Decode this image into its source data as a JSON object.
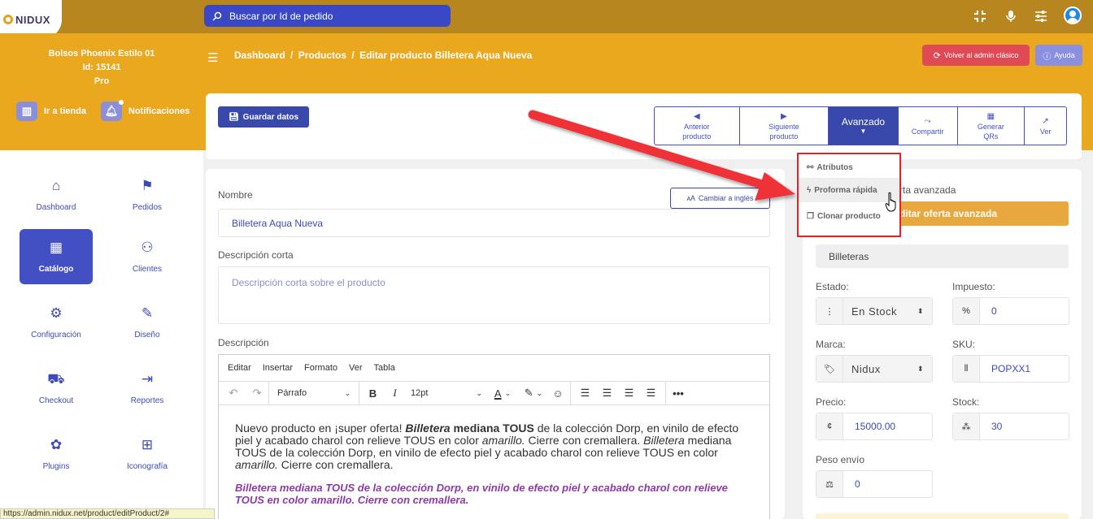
{
  "topbar": {
    "logo_text": "NIDUX",
    "search_placeholder": "Buscar por Id de pedido"
  },
  "store": {
    "name": "Bolsos Phoenix Estilo 01",
    "id": "Id: 15141",
    "plan": "Pro",
    "go_store": "Ir a tienda",
    "notifications": "Notificaciones"
  },
  "breadcrumb": {
    "dashboard": "Dashboard",
    "products": "Productos",
    "current": "Editar producto Billetera Aqua Nueva",
    "sep": "/"
  },
  "header_buttons": {
    "old_admin": "Volver al admin clásico",
    "help": "Ayuda"
  },
  "sidebar": {
    "items": [
      {
        "label": "Dashboard",
        "icon": "home-icon",
        "glyph": "⌂"
      },
      {
        "label": "Pedidos",
        "icon": "flag-icon",
        "glyph": "⚑"
      },
      {
        "label": "Catálogo",
        "icon": "boxes-icon",
        "glyph": "▦"
      },
      {
        "label": "Clientes",
        "icon": "users-icon",
        "glyph": "⚇"
      },
      {
        "label": "Configuración",
        "icon": "cubes-icon",
        "glyph": "⚙"
      },
      {
        "label": "Diseño",
        "icon": "brush-icon",
        "glyph": "✎"
      },
      {
        "label": "Checkout",
        "icon": "checkout-icon",
        "glyph": "⛟"
      },
      {
        "label": "Reportes",
        "icon": "report-icon",
        "glyph": "⇥"
      },
      {
        "label": "Plugins",
        "icon": "puzzle-icon",
        "glyph": "✿"
      },
      {
        "label": "Iconografía",
        "icon": "grid-icon",
        "glyph": "⊞"
      }
    ]
  },
  "actions": {
    "save": "Guardar datos",
    "prev": "Anterior producto",
    "next": "Siguiente producto",
    "advanced": "Avanzado",
    "share": "Compartir",
    "qr": "Generar QRs",
    "view": "Ver"
  },
  "dropdown": {
    "attributes": "Atributos",
    "quick_proforma": "Proforma rápida",
    "clone": "Clonar producto"
  },
  "form": {
    "name_label": "Nombre",
    "name_value": "Billetera Aqua Nueva",
    "english_button": "Cambiar a inglés",
    "short_desc_label": "Descripción corta",
    "short_desc_placeholder": "Descripción corta sobre el producto",
    "desc_label": "Descripción"
  },
  "editor": {
    "menu": [
      "Editar",
      "Insertar",
      "Formato",
      "Ver",
      "Tabla"
    ],
    "block_format": "Párrafo",
    "font_size": "12pt",
    "text_a": "Nuevo producto en ¡super oferta! ",
    "text_b": "Billetera",
    "text_c": " mediana TOUS",
    "text_d": " de la colección Dorp, en vinilo de efecto piel y acabado charol con relieve TOUS en color ",
    "text_e": "amarillo.",
    "text_f": " Cierre con cremallera. ",
    "text_g": "Billetera",
    "text_h": " mediana TOUS de la colección Dorp, en vinilo de efecto piel y acabado charol con relieve TOUS en color ",
    "text_i": "amarillo.",
    "text_j": " Cierre con cremallera.",
    "paragraph2": "Billetera mediana TOUS de la colección Dorp, en vinilo de efecto piel y acabado charol con relieve TOUS en color amarillo. Cierre con cremallera."
  },
  "right": {
    "offer_partial": "rta avanzada",
    "offer_button_partial": "ditar oferta avanzada",
    "category": "Billeteras",
    "state_label": "Estado:",
    "state_value": "En Stock",
    "tax_label": "Impuesto:",
    "tax_value": "0",
    "brand_label": "Marca:",
    "brand_value": "Nidux",
    "sku_label": "SKU:",
    "sku_value": "POPXX1",
    "price_label": "Precio:",
    "price_value": "15000.00",
    "currency_symbol": "¢",
    "stock_label": "Stock:",
    "stock_value": "30",
    "weight_label": "Peso envío",
    "weight_value": "0"
  },
  "status_bar": "https://admin.nidux.net/product/editProduct/2#"
}
